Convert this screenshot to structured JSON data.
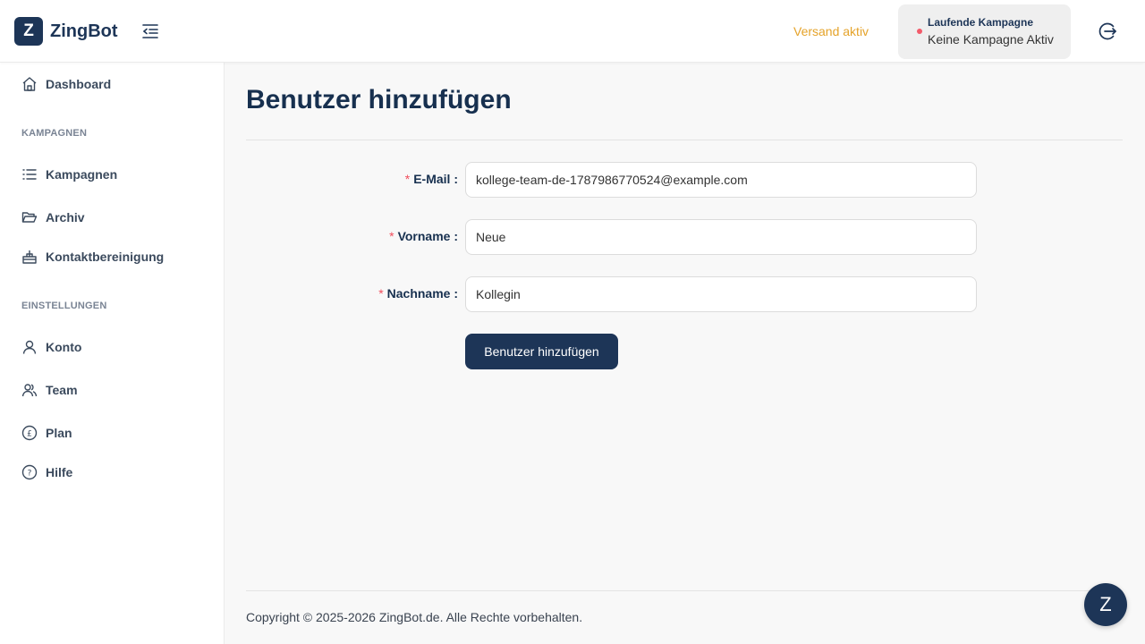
{
  "app": {
    "logo_letter": "Z",
    "name": "ZingBot"
  },
  "header": {
    "status": "Versand aktiv",
    "campaign_label": "Laufende Kampagne",
    "campaign_value": "Keine Kampagne Aktiv"
  },
  "sidebar": {
    "dashboard": "Dashboard",
    "section_campaigns": "KAMPAGNEN",
    "campaigns": "Kampagnen",
    "archive": "Archiv",
    "cleanup": "Kontaktbereinigung",
    "section_settings": "EINSTELLUNGEN",
    "account": "Konto",
    "team": "Team",
    "plan": "Plan",
    "help": "Hilfe"
  },
  "page": {
    "title": "Benutzer hinzufügen"
  },
  "form": {
    "required_mark": "*",
    "email_label": "E-Mail :",
    "email_value": "kollege-team-de-1787986770524@example.com",
    "firstname_label": "Vorname :",
    "firstname_value": "Neue",
    "lastname_label": "Nachname :",
    "lastname_value": "Kollegin",
    "submit_label": "Benutzer hinzufügen"
  },
  "footer": {
    "copyright": "Copyright © 2025-2026 ZingBot.de. Alle Rechte vorbehalten."
  },
  "chat": {
    "label": "Z"
  },
  "colors": {
    "brand": "#1d3557",
    "status": "#e5a32a",
    "required": "#f04c5b",
    "indicator": "#f35b6a"
  }
}
